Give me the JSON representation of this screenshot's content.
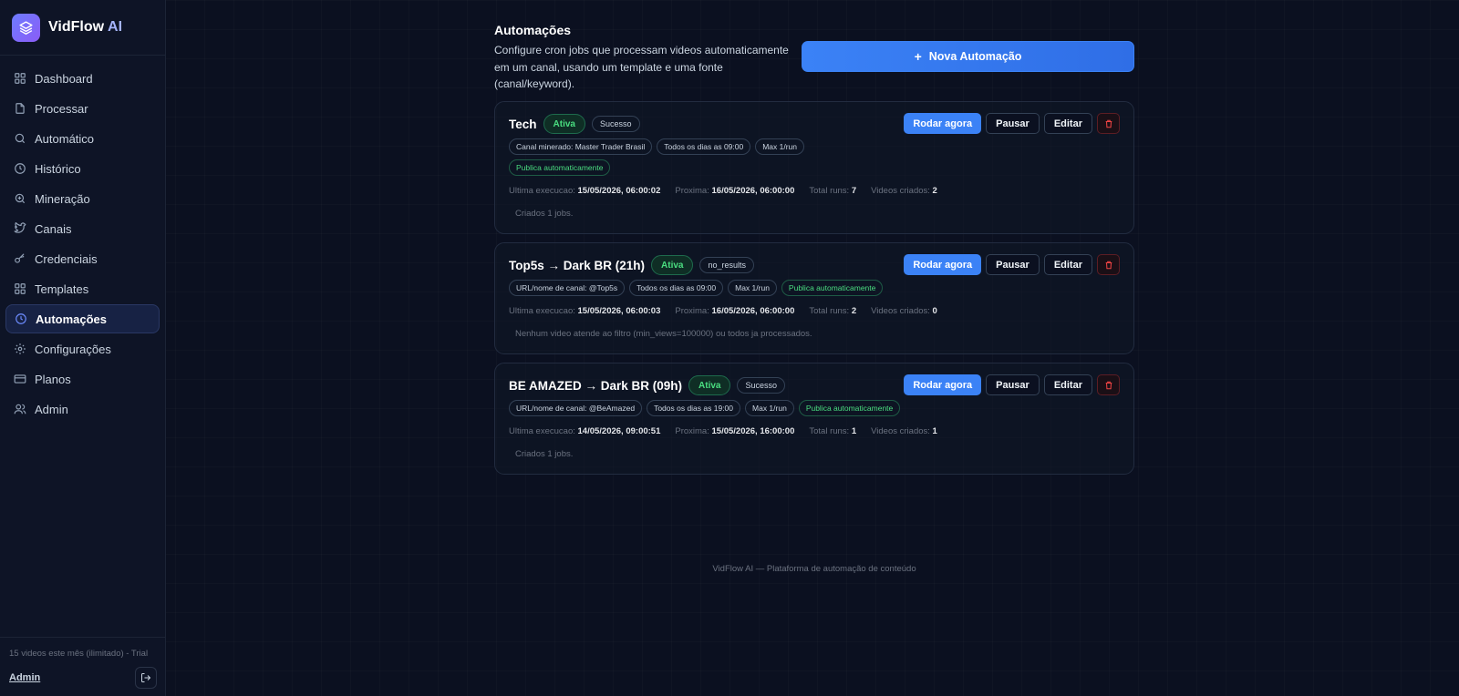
{
  "brand": {
    "name": "VidFlow",
    "suffix": "AI"
  },
  "nav": [
    {
      "label": "Dashboard",
      "icon": "grid-icon"
    },
    {
      "label": "Processar",
      "icon": "file-icon"
    },
    {
      "label": "Automático",
      "icon": "search-icon"
    },
    {
      "label": "Histórico",
      "icon": "clock-icon"
    },
    {
      "label": "Mineração",
      "icon": "zoom-icon"
    },
    {
      "label": "Canais",
      "icon": "bird-icon"
    },
    {
      "label": "Credenciais",
      "icon": "key-icon"
    },
    {
      "label": "Templates",
      "icon": "grid-icon"
    },
    {
      "label": "Automações",
      "icon": "clock-icon",
      "active": true
    },
    {
      "label": "Configurações",
      "icon": "gear-icon"
    },
    {
      "label": "Planos",
      "icon": "card-icon"
    },
    {
      "label": "Admin",
      "icon": "users-icon"
    }
  ],
  "sidebar_footer": {
    "usage": "15 videos este mês (ilimitado) - Trial",
    "user": "Admin"
  },
  "header": {
    "title": "Automações",
    "description": "Configure cron jobs que processam videos automaticamente em um canal, usando um template e uma fonte (canal/keyword).",
    "new_button": "Nova Automação"
  },
  "actions": {
    "run": "Rodar agora",
    "pause": "Pausar",
    "edit": "Editar"
  },
  "stat_labels": {
    "last": "Ultima execucao:",
    "next": "Proxima:",
    "runs": "Total runs:",
    "videos": "Videos criados:"
  },
  "cards": [
    {
      "title": "Tech",
      "state": "Ativa",
      "status": "Sucesso",
      "tags": [
        "Canal minerado: Master Trader Brasil",
        "Todos os dias as 09:00",
        "Max 1/run"
      ],
      "green_tag": "Publica automaticamente",
      "last": "15/05/2026, 06:00:02",
      "next": "16/05/2026, 06:00:00",
      "runs": "7",
      "videos": "2",
      "note": "Criados 1 jobs."
    },
    {
      "title": "Top5s → Dark BR (21h)",
      "state": "Ativa",
      "status": "no_results",
      "tags": [
        "URL/nome de canal: @Top5s",
        "Todos os dias as 09:00",
        "Max 1/run"
      ],
      "green_tag": "Publica automaticamente",
      "last": "15/05/2026, 06:00:03",
      "next": "16/05/2026, 06:00:00",
      "runs": "2",
      "videos": "0",
      "note": "Nenhum video atende ao filtro (min_views=100000) ou todos ja processados."
    },
    {
      "title": "BE AMAZED → Dark BR (09h)",
      "state": "Ativa",
      "status": "Sucesso",
      "tags": [
        "URL/nome de canal: @BeAmazed",
        "Todos os dias as 19:00",
        "Max 1/run"
      ],
      "green_tag": "Publica automaticamente",
      "last": "14/05/2026, 09:00:51",
      "next": "15/05/2026, 16:00:00",
      "runs": "1",
      "videos": "1",
      "note": "Criados 1 jobs."
    }
  ],
  "footer": "VidFlow AI — Plataforma de automação de conteúdo"
}
